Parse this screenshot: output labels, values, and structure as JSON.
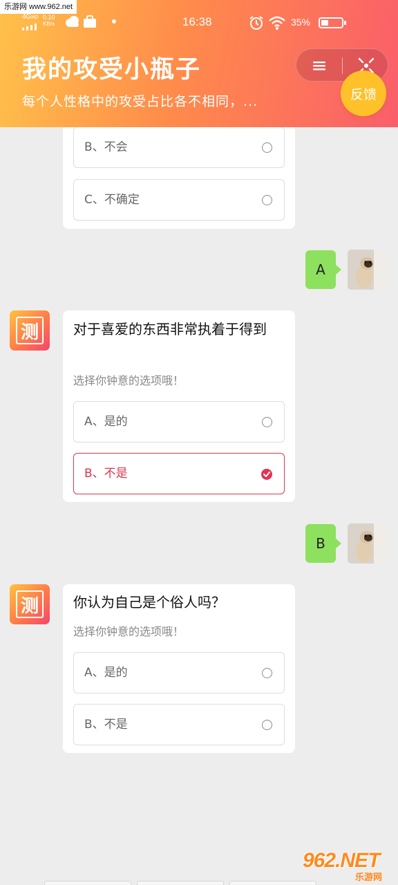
{
  "watermark": {
    "top_text": "乐游网 www.962.net",
    "logo": "962.NET",
    "site_name": "乐游网"
  },
  "status_bar": {
    "network": "4G",
    "network_sub": "HD",
    "speed_value": "0.10",
    "speed_unit": "KB/s",
    "time": "16:38",
    "battery_percent": "35%",
    "battery_level": 0.35,
    "icons": [
      "cloud-icon",
      "bag-icon",
      "alarm-icon",
      "wifi-icon",
      "battery-icon"
    ]
  },
  "header": {
    "title": "我的攻受小瓶子",
    "subtitle": "每个人性格中的攻受占比各不相同，...",
    "menu_icon": "≡",
    "feedback_label": "反馈"
  },
  "chat": {
    "card1": {
      "options": [
        {
          "label": "B、不会",
          "selected": false
        },
        {
          "label": "C、不确定",
          "selected": false
        }
      ]
    },
    "reply1": "A",
    "bot_glyph": "测",
    "card2": {
      "question": "对于喜爱的东西非常执着于得到",
      "hint": "选择你钟意的选项哦！",
      "options": [
        {
          "label": "A、是的",
          "selected": false
        },
        {
          "label": "B、不是",
          "selected": true
        }
      ]
    },
    "reply2": "B",
    "card3": {
      "question": "你认为自己是个俗人吗？",
      "hint": "选择你钟意的选项哦！",
      "options": [
        {
          "label": "A、是的",
          "selected": false
        },
        {
          "label": "B、不是",
          "selected": false
        }
      ]
    }
  },
  "colors": {
    "accent": "#d8374f",
    "bubble": "#8ee05f",
    "feedback": "#ffc12a",
    "header_start": "#ffc14a",
    "header_end": "#fa5e6a"
  }
}
